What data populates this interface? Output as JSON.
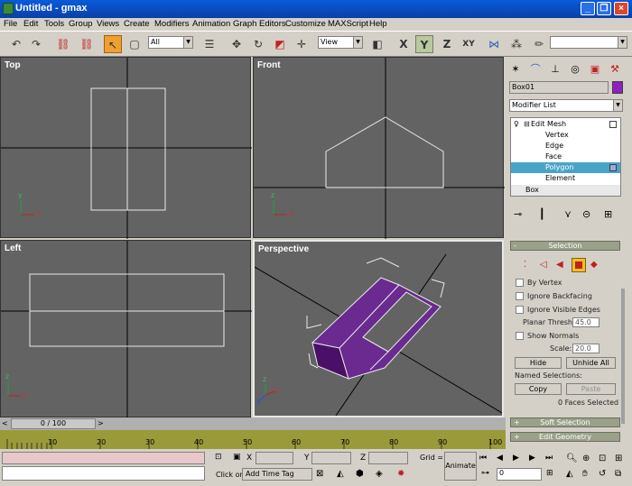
{
  "window": {
    "title": "Untitled - gmax"
  },
  "menu": [
    "File",
    "Edit",
    "Tools",
    "Group",
    "Views",
    "Create",
    "Modifiers",
    "Animation",
    "Graph Editors",
    "Customize",
    "MAXScript",
    "Help"
  ],
  "toolbar": {
    "filter": "All",
    "coord": "View"
  },
  "viewports": {
    "top": "Top",
    "front": "Front",
    "left": "Left",
    "perspective": "Perspective"
  },
  "axis": {
    "x": "x",
    "y": "y",
    "z": "z"
  },
  "time": {
    "slider": "0 / 100",
    "ticks": [
      "10",
      "20",
      "30",
      "40",
      "50",
      "60",
      "70",
      "80",
      "90",
      "100"
    ]
  },
  "panel": {
    "object_name": "Box01",
    "modifier_list": "Modifier List",
    "stack": [
      "Edit Mesh",
      "Vertex",
      "Edge",
      "Face",
      "Polygon",
      "Element",
      "Box"
    ],
    "selection_title": "Selection",
    "by_vertex": "By Vertex",
    "ignore_backfacing": "Ignore Backfacing",
    "ignore_visible_edges": "Ignore Visible Edges",
    "planar_thresh_label": "Planar Thresh:",
    "planar_thresh": "45.0",
    "show_normals": "Show Normals",
    "scale_label": "Scale:",
    "scale": "20.0",
    "hide": "Hide",
    "unhide_all": "Unhide All",
    "named_selections": "Named Selections:",
    "copy": "Copy",
    "paste": "Paste",
    "faces_selected": "0 Faces Selected",
    "soft_selection": "Soft Selection",
    "edit_geometry": "Edit Geometry"
  },
  "status": {
    "x_label": "X",
    "y_label": "Y",
    "z_label": "Z",
    "grid": "Grid =",
    "click_or": "Click or",
    "add_time_tag": "Add Time Tag",
    "animate": "Animate",
    "frame": "0"
  },
  "colors": {
    "title": "#0a5bd8",
    "object": "#5a1a78",
    "object_swatch": "#9020c0"
  }
}
